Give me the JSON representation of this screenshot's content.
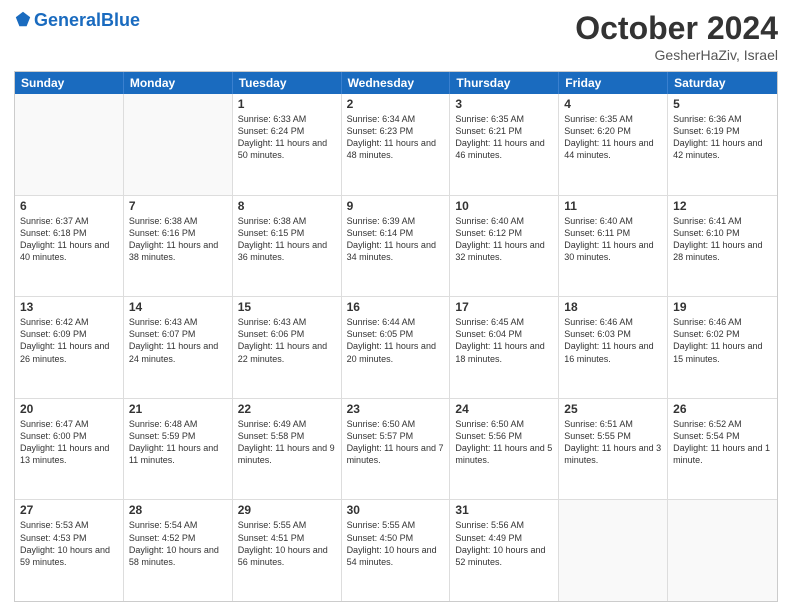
{
  "header": {
    "logo_general": "General",
    "logo_blue": "Blue",
    "month": "October 2024",
    "location": "GesherHaZiv, Israel"
  },
  "weekdays": [
    "Sunday",
    "Monday",
    "Tuesday",
    "Wednesday",
    "Thursday",
    "Friday",
    "Saturday"
  ],
  "rows": [
    [
      {
        "day": "",
        "info": ""
      },
      {
        "day": "",
        "info": ""
      },
      {
        "day": "1",
        "info": "Sunrise: 6:33 AM\nSunset: 6:24 PM\nDaylight: 11 hours and 50 minutes."
      },
      {
        "day": "2",
        "info": "Sunrise: 6:34 AM\nSunset: 6:23 PM\nDaylight: 11 hours and 48 minutes."
      },
      {
        "day": "3",
        "info": "Sunrise: 6:35 AM\nSunset: 6:21 PM\nDaylight: 11 hours and 46 minutes."
      },
      {
        "day": "4",
        "info": "Sunrise: 6:35 AM\nSunset: 6:20 PM\nDaylight: 11 hours and 44 minutes."
      },
      {
        "day": "5",
        "info": "Sunrise: 6:36 AM\nSunset: 6:19 PM\nDaylight: 11 hours and 42 minutes."
      }
    ],
    [
      {
        "day": "6",
        "info": "Sunrise: 6:37 AM\nSunset: 6:18 PM\nDaylight: 11 hours and 40 minutes."
      },
      {
        "day": "7",
        "info": "Sunrise: 6:38 AM\nSunset: 6:16 PM\nDaylight: 11 hours and 38 minutes."
      },
      {
        "day": "8",
        "info": "Sunrise: 6:38 AM\nSunset: 6:15 PM\nDaylight: 11 hours and 36 minutes."
      },
      {
        "day": "9",
        "info": "Sunrise: 6:39 AM\nSunset: 6:14 PM\nDaylight: 11 hours and 34 minutes."
      },
      {
        "day": "10",
        "info": "Sunrise: 6:40 AM\nSunset: 6:12 PM\nDaylight: 11 hours and 32 minutes."
      },
      {
        "day": "11",
        "info": "Sunrise: 6:40 AM\nSunset: 6:11 PM\nDaylight: 11 hours and 30 minutes."
      },
      {
        "day": "12",
        "info": "Sunrise: 6:41 AM\nSunset: 6:10 PM\nDaylight: 11 hours and 28 minutes."
      }
    ],
    [
      {
        "day": "13",
        "info": "Sunrise: 6:42 AM\nSunset: 6:09 PM\nDaylight: 11 hours and 26 minutes."
      },
      {
        "day": "14",
        "info": "Sunrise: 6:43 AM\nSunset: 6:07 PM\nDaylight: 11 hours and 24 minutes."
      },
      {
        "day": "15",
        "info": "Sunrise: 6:43 AM\nSunset: 6:06 PM\nDaylight: 11 hours and 22 minutes."
      },
      {
        "day": "16",
        "info": "Sunrise: 6:44 AM\nSunset: 6:05 PM\nDaylight: 11 hours and 20 minutes."
      },
      {
        "day": "17",
        "info": "Sunrise: 6:45 AM\nSunset: 6:04 PM\nDaylight: 11 hours and 18 minutes."
      },
      {
        "day": "18",
        "info": "Sunrise: 6:46 AM\nSunset: 6:03 PM\nDaylight: 11 hours and 16 minutes."
      },
      {
        "day": "19",
        "info": "Sunrise: 6:46 AM\nSunset: 6:02 PM\nDaylight: 11 hours and 15 minutes."
      }
    ],
    [
      {
        "day": "20",
        "info": "Sunrise: 6:47 AM\nSunset: 6:00 PM\nDaylight: 11 hours and 13 minutes."
      },
      {
        "day": "21",
        "info": "Sunrise: 6:48 AM\nSunset: 5:59 PM\nDaylight: 11 hours and 11 minutes."
      },
      {
        "day": "22",
        "info": "Sunrise: 6:49 AM\nSunset: 5:58 PM\nDaylight: 11 hours and 9 minutes."
      },
      {
        "day": "23",
        "info": "Sunrise: 6:50 AM\nSunset: 5:57 PM\nDaylight: 11 hours and 7 minutes."
      },
      {
        "day": "24",
        "info": "Sunrise: 6:50 AM\nSunset: 5:56 PM\nDaylight: 11 hours and 5 minutes."
      },
      {
        "day": "25",
        "info": "Sunrise: 6:51 AM\nSunset: 5:55 PM\nDaylight: 11 hours and 3 minutes."
      },
      {
        "day": "26",
        "info": "Sunrise: 6:52 AM\nSunset: 5:54 PM\nDaylight: 11 hours and 1 minute."
      }
    ],
    [
      {
        "day": "27",
        "info": "Sunrise: 5:53 AM\nSunset: 4:53 PM\nDaylight: 10 hours and 59 minutes."
      },
      {
        "day": "28",
        "info": "Sunrise: 5:54 AM\nSunset: 4:52 PM\nDaylight: 10 hours and 58 minutes."
      },
      {
        "day": "29",
        "info": "Sunrise: 5:55 AM\nSunset: 4:51 PM\nDaylight: 10 hours and 56 minutes."
      },
      {
        "day": "30",
        "info": "Sunrise: 5:55 AM\nSunset: 4:50 PM\nDaylight: 10 hours and 54 minutes."
      },
      {
        "day": "31",
        "info": "Sunrise: 5:56 AM\nSunset: 4:49 PM\nDaylight: 10 hours and 52 minutes."
      },
      {
        "day": "",
        "info": ""
      },
      {
        "day": "",
        "info": ""
      }
    ]
  ]
}
